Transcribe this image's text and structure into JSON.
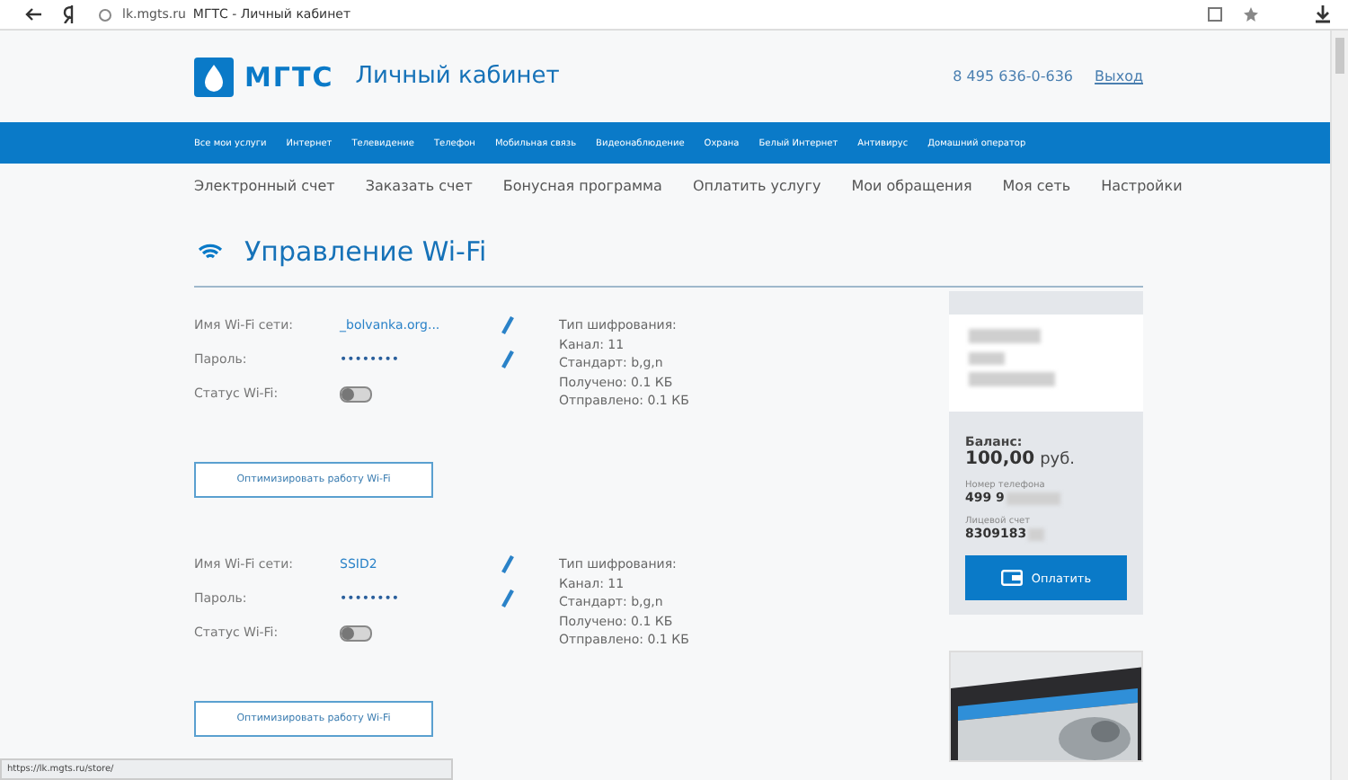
{
  "browser": {
    "address": "lk.mgts.ru",
    "title": "МГТС - Личный кабинет",
    "status_url": "https://lk.mgts.ru/store/"
  },
  "header": {
    "logo": "МГТС",
    "title": "Личный кабинет",
    "phone": "8 495 636-0-636",
    "logout": "Выход"
  },
  "nav": [
    "Все мои услуги",
    "Интернет",
    "Телевидение",
    "Телефон",
    "Мобильная связь",
    "Видеонаблюдение",
    "Охрана",
    "Белый Интернет",
    "Антивирус",
    "Домашний оператор"
  ],
  "subnav": [
    "Электронный счет",
    "Заказать счет",
    "Бонусная программа",
    "Оплатить услугу",
    "Мои обращения",
    "Моя сеть",
    "Настройки"
  ],
  "page_title": "Управление Wi-Fi",
  "networks": [
    {
      "name_label": "Имя Wi-Fi сети:",
      "name": "_bolvanka.org...",
      "password_label": "Пароль:",
      "password": "••••••••",
      "status_label": "Статус Wi-Fi:",
      "on": false,
      "info": [
        "Тип шифрования:",
        "Канал: 11",
        "Стандарт: b,g,n",
        "Получено: 0.1 КБ",
        "Отправлено: 0.1 КБ"
      ],
      "button": "Оптимизировать работу Wi-Fi"
    },
    {
      "name_label": "Имя Wi-Fi сети:",
      "name": "SSID2",
      "password_label": "Пароль:",
      "password": "••••••••",
      "status_label": "Статус Wi-Fi:",
      "on": false,
      "info": [
        "Тип шифрования:",
        "Канал: 11",
        "Стандарт: b,g,n",
        "Получено: 0.1 КБ",
        "Отправлено: 0.1 КБ"
      ],
      "button": "Оптимизировать работу Wi-Fi"
    }
  ],
  "account": {
    "balance_label": "Баланс:",
    "balance": "100,00",
    "currency": "руб.",
    "phone_label": "Номер телефона",
    "phone": "499 9",
    "account_label": "Лицевой счет",
    "account": "8309183",
    "pay_button": "Оплатить"
  }
}
